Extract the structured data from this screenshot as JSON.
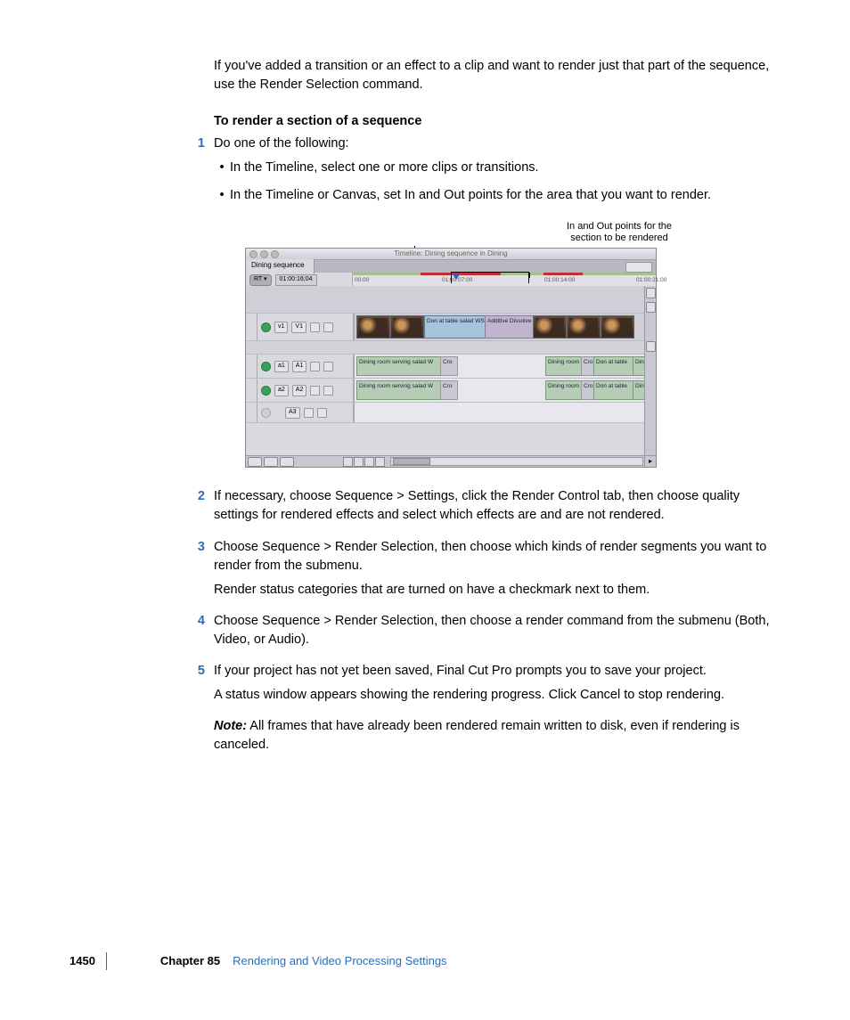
{
  "intro": "If you've added a transition or an effect to a clip and want to render just that part of the sequence, use the Render Selection command.",
  "heading": "To render a section of a sequence",
  "step1": {
    "num": "1",
    "text": "Do one of the following:"
  },
  "bullets": [
    "In the Timeline, select one or more clips or transitions.",
    "In the Timeline or Canvas, set In and Out points for the area that you want to render."
  ],
  "callout": {
    "line1": "In and Out points for the",
    "line2": "section to be rendered"
  },
  "timeline": {
    "title": "Timeline: Dining sequence in Dining",
    "tab": "Dining sequence",
    "rt": "RT ▾",
    "timecode": "01:00:16;04",
    "ticks": [
      "00:00",
      "01:00:07:00",
      "01:00:14:00",
      "01:00:21:00"
    ],
    "tracks": {
      "v1a": "v1",
      "v1b": "V1",
      "a1a": "a1",
      "a1b": "A1",
      "a2a": "a2",
      "a2b": "A2",
      "a3": "A3"
    },
    "clips": {
      "videoLabel": "Don at table salad WS",
      "dissolve": "Additive Dissolve",
      "audio1": "Dining room serving salad W",
      "audioCross": "Cro",
      "audioRight1": "Dining room",
      "audioRight2": "Cro",
      "audioRight3": "Don at table",
      "audioRight4": "Dini"
    }
  },
  "step2": {
    "num": "2",
    "text": "If necessary, choose Sequence > Settings, click the Render Control tab, then choose quality settings for rendered effects and select which effects are and are not rendered."
  },
  "step3": {
    "num": "3",
    "text": "Choose Sequence > Render Selection, then choose which kinds of render segments you want to render from the submenu."
  },
  "step3_sub": "Render status categories that are turned on have a checkmark next to them.",
  "step4": {
    "num": "4",
    "text": "Choose Sequence > Render Selection, then choose a render command from the submenu (Both, Video, or Audio)."
  },
  "step5": {
    "num": "5",
    "text": "If your project has not yet been saved, Final Cut Pro prompts you to save your project."
  },
  "step5_sub": "A status window appears showing the rendering progress. Click Cancel to stop rendering.",
  "note": {
    "label": "Note:",
    "text": "  All frames that have already been rendered remain written to disk, even if rendering is canceled."
  },
  "footer": {
    "page": "1450",
    "chapter": "Chapter 85",
    "title": "Rendering and Video Processing Settings"
  }
}
